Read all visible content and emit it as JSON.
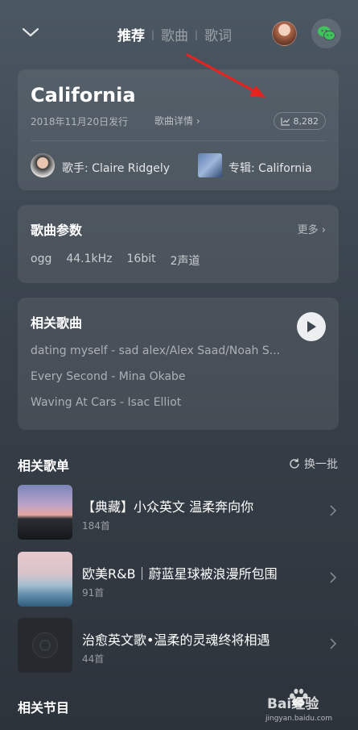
{
  "tabs": [
    {
      "label": "推荐",
      "active": true
    },
    {
      "label": "歌曲",
      "active": false
    },
    {
      "label": "歌词",
      "active": false
    }
  ],
  "song": {
    "title": "California",
    "release": "2018年11月20日发行",
    "detail_link": "歌曲详情",
    "plays": "8,282",
    "artist": "歌手: Claire Ridgely",
    "album": "专辑: California"
  },
  "params": {
    "title": "歌曲参数",
    "more": "更多",
    "values": [
      "ogg",
      "44.1kHz",
      "16bit",
      "2声道"
    ]
  },
  "related_songs": {
    "title": "相关歌曲",
    "items": [
      "dating myself - sad alex/Alex Saad/Noah S...",
      "Every Second - Mina Okabe",
      "Waving At Cars - Isac Elliot"
    ]
  },
  "related_playlists": {
    "title": "相关歌单",
    "refresh": "换一批",
    "items": [
      {
        "title": "【典藏】小众英文 温柔奔向你",
        "count": "184首"
      },
      {
        "title": "欧美R&B｜蔚蓝星球被浪漫所包围",
        "count": "91首"
      },
      {
        "title": "治愈英文歌•温柔的灵魂终将相遇",
        "count": "44首"
      }
    ]
  },
  "related_programs": {
    "title": "相关节目"
  },
  "watermark": {
    "brand": "Bai经验",
    "url": "jingyan.baidu.com"
  },
  "colors": {
    "annotation_arrow": "#e8231f",
    "wechat": "#3fc25a"
  }
}
